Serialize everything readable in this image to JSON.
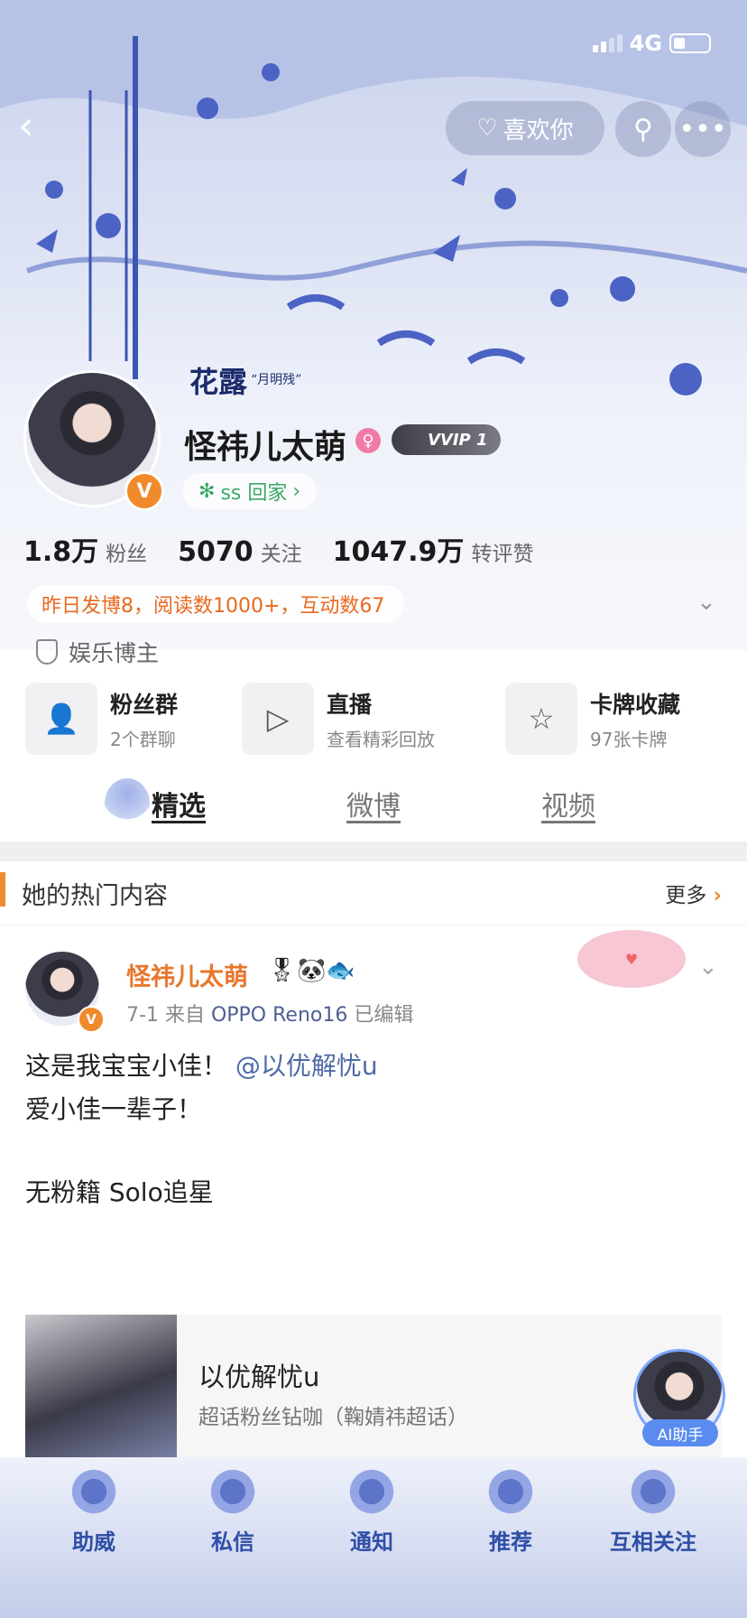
{
  "status_bar": {
    "network": "4G"
  },
  "header": {
    "like_label": "喜欢你",
    "calligraphy": "花露",
    "calligraphy_sub": "“月明残”"
  },
  "profile": {
    "name": "怪祎儿太萌",
    "vip_label": "VVIP 1",
    "ss_label": "ss 回家",
    "stats": [
      {
        "value": "1.8万",
        "label": "粉丝"
      },
      {
        "value": "5070",
        "label": "关注"
      },
      {
        "value": "1047.9万",
        "label": "转评赞"
      }
    ],
    "yesterday": "昨日发博8，阅读数1000+，互动数67",
    "tag": "娱乐博主"
  },
  "entries": [
    {
      "title": "粉丝群",
      "sub": "2个群聊",
      "icon": "people-icon"
    },
    {
      "title": "直播",
      "sub": "查看精彩回放",
      "icon": "tv-icon"
    },
    {
      "title": "卡牌收藏",
      "sub": "97张卡牌",
      "icon": "card-icon"
    }
  ],
  "tabs": [
    "精选",
    "微博",
    "视频"
  ],
  "hot": {
    "title": "她的热门内容",
    "more": "更多"
  },
  "post": {
    "author": "怪祎儿太萌",
    "date": "7-1",
    "from_prefix": "来自",
    "device": "OPPO Reno16",
    "edited": "已编辑",
    "line1": "这是我宝宝小佳！",
    "mention": "@以优解忧u",
    "line2": "爱小佳一辈子！",
    "line3": "无粉籍   Solo追星"
  },
  "card": {
    "title": "以优解忧u",
    "sub": "超话粉丝钻咖（鞠婧祎超话）"
  },
  "ai_label": "AI助手",
  "nav": [
    "助威",
    "私信",
    "通知",
    "推荐",
    "互相关注"
  ],
  "colors": {
    "accent": "#f08a2b",
    "link": "#4e6aa6",
    "nav_text": "#2f4ea6"
  }
}
